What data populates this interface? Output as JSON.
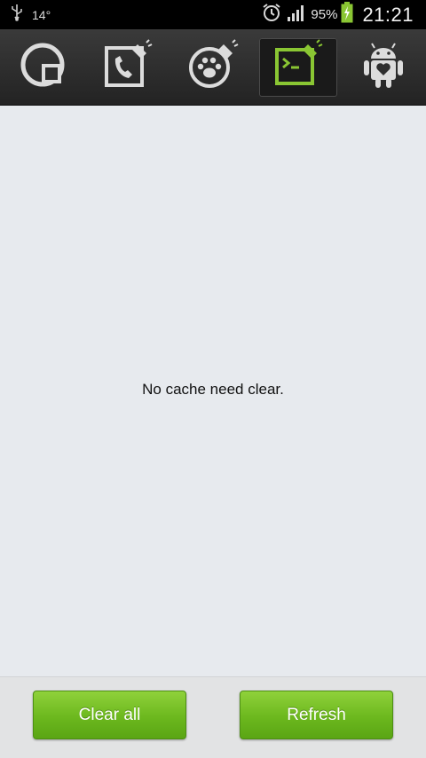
{
  "status_bar": {
    "temperature": "14°",
    "battery_percent": "95%",
    "time": "21:21",
    "icons": [
      "usb-icon",
      "alarm-icon",
      "signal-icon",
      "battery-charging-icon"
    ]
  },
  "tabs": [
    {
      "icon": "pie-chart-icon",
      "active": false
    },
    {
      "icon": "call-log-clean-icon",
      "active": false
    },
    {
      "icon": "browser-paw-clean-icon",
      "active": false
    },
    {
      "icon": "terminal-cache-clean-icon",
      "active": true
    },
    {
      "icon": "android-heart-icon",
      "active": false
    }
  ],
  "main": {
    "message": "No cache need clear."
  },
  "actions": {
    "clear_all_label": "Clear all",
    "refresh_label": "Refresh"
  },
  "colors": {
    "accent": "#8fd13a",
    "active_icon": "#8ac633",
    "inactive_icon": "#d8d8d8"
  }
}
